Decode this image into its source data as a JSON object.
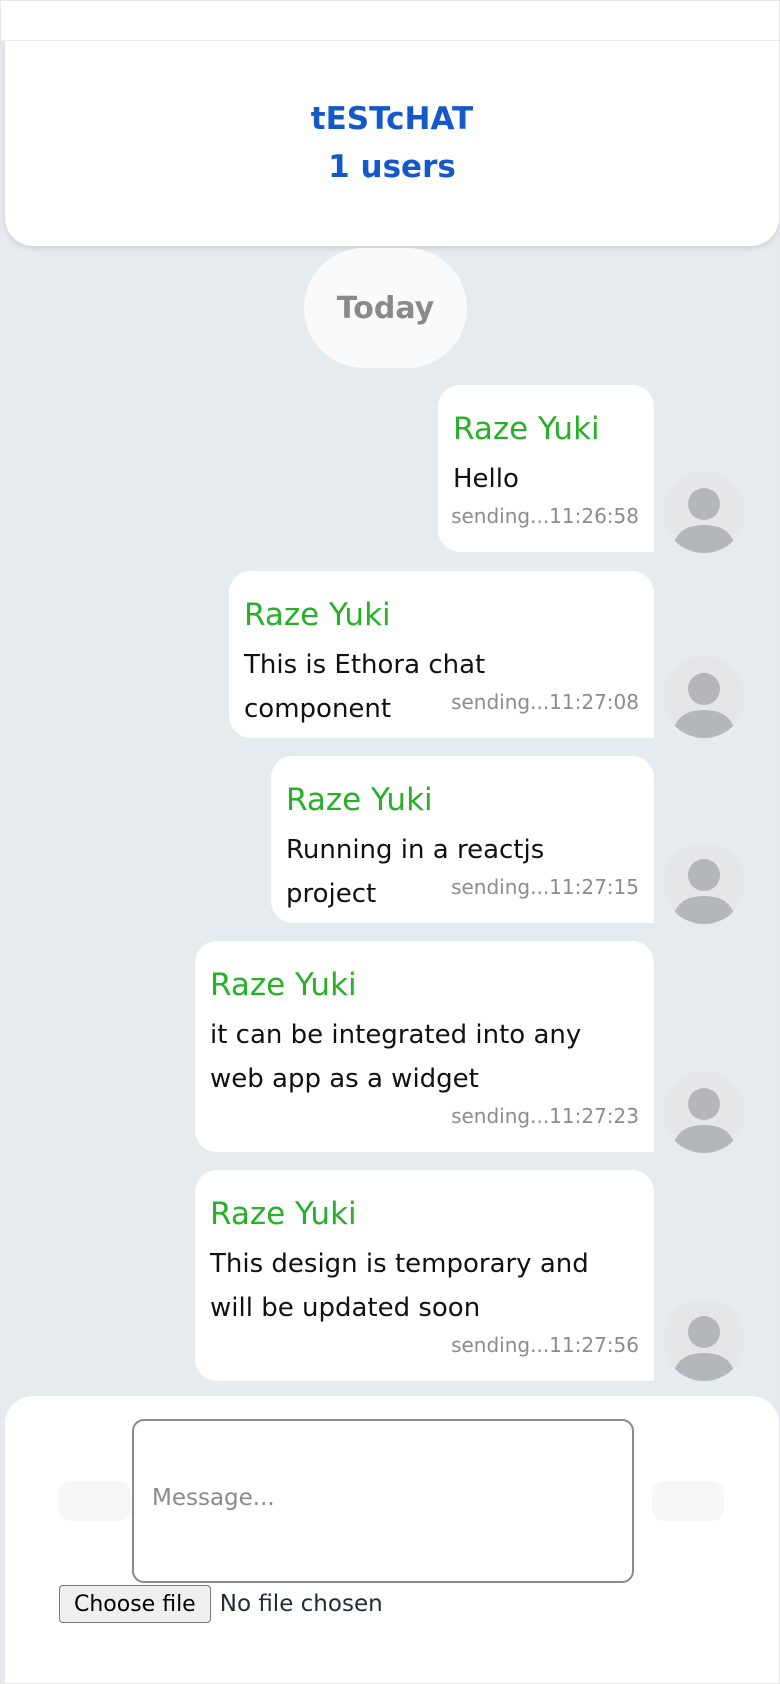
{
  "header": {
    "title": "tESTcHAT",
    "users": "1 users"
  },
  "date_separator": "Today",
  "messages": [
    {
      "sender": "Raze Yuki",
      "text": "Hello",
      "time": "sending...11:26:58"
    },
    {
      "sender": "Raze Yuki",
      "text": "This is Ethora chat component",
      "time": "sending...11:27:08"
    },
    {
      "sender": "Raze Yuki",
      "text": "Running in a reactjs project",
      "time": "sending...11:27:15"
    },
    {
      "sender": "Raze Yuki",
      "text": "it can be integrated into any web app as a widget",
      "time": "sending...11:27:23"
    },
    {
      "sender": "Raze Yuki",
      "text": "This design is temporary and will be updated soon",
      "time": "sending...11:27:56"
    }
  ],
  "composer": {
    "placeholder": "Message...",
    "file_button": "Choose file",
    "file_status": "No file chosen"
  },
  "colors": {
    "accent": "#1458c9",
    "sender_name": "#28b02a",
    "chat_background": "#e6ebf0"
  }
}
